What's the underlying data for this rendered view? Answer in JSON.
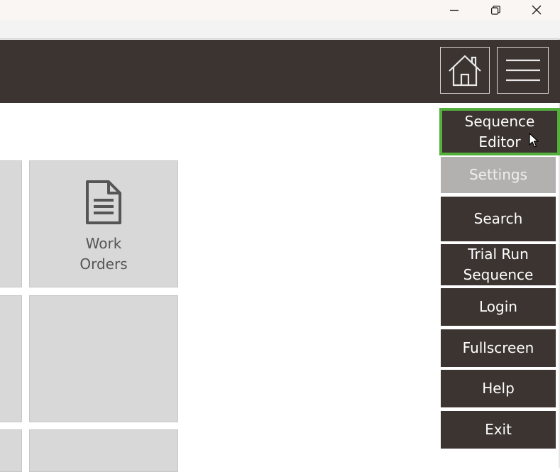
{
  "window": {
    "controls": [
      "minimize-icon",
      "maximize-icon",
      "close-icon"
    ]
  },
  "header": {
    "home_icon": "home-icon",
    "menu_icon": "hamburger-menu-icon"
  },
  "tiles": [
    {
      "label": "Work\nOrders",
      "icon": "document-icon"
    },
    {
      "label": ""
    },
    {
      "label": ""
    }
  ],
  "side_menu": {
    "items": [
      {
        "label": "Sequence Editor",
        "state": "selected"
      },
      {
        "label": "Settings",
        "state": "disabled"
      },
      {
        "label": "Search",
        "state": "normal"
      },
      {
        "label": "Trial Run Sequence",
        "state": "normal"
      },
      {
        "label": "Login",
        "state": "normal"
      },
      {
        "label": "Fullscreen",
        "state": "normal"
      },
      {
        "label": "Help",
        "state": "normal"
      },
      {
        "label": "Exit",
        "state": "normal"
      }
    ]
  },
  "colors": {
    "header_bg": "#3c3431",
    "menu_bg": "#3c3431",
    "selected_border": "#54b03c",
    "disabled_bg": "#b3b1b0",
    "tile_bg": "#d8d8d8",
    "tile_text": "#555555"
  }
}
